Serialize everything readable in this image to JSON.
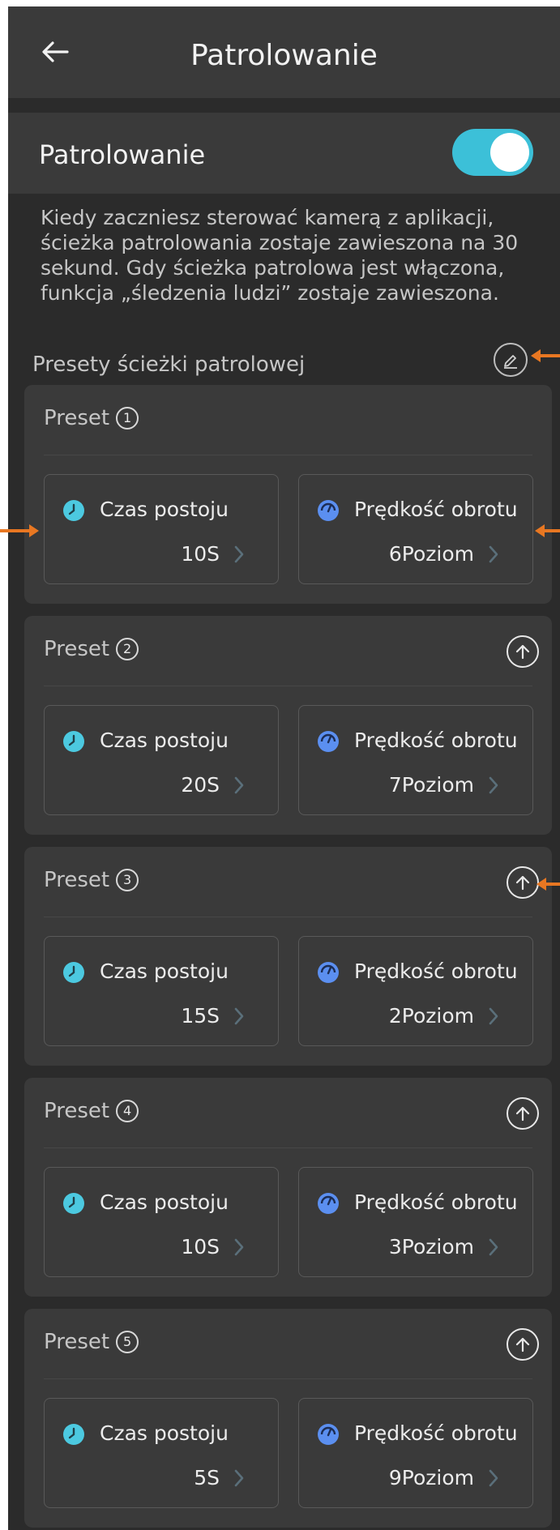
{
  "header": {
    "title": "Patrolowanie"
  },
  "toggle": {
    "label": "Patrolowanie",
    "state": "on"
  },
  "description": "Kiedy zaczniesz sterować kamerą z aplikacji, ścieżka patrolowania zostaje zawieszona na 30 sekund. Gdy ścieżka patrolowa jest włączona, funkcja „śledzenia ludzi” zostaje zawieszona.",
  "section": {
    "title": "Presety ścieżki patrolowej"
  },
  "colors": {
    "accent": "#3cc0d8",
    "annotation": "#e87722",
    "clock": "#4cc9e0",
    "gauge": "#5b8ff0"
  },
  "presets": [
    {
      "label": "Preset",
      "number": "1",
      "dwell_label": "Czas postoju",
      "dwell_value": "10S",
      "speed_label": "Prędkość obrotu",
      "speed_value": "6Poziom"
    },
    {
      "label": "Preset",
      "number": "2",
      "dwell_label": "Czas postoju",
      "dwell_value": "20S",
      "speed_label": "Prędkość obrotu",
      "speed_value": "7Poziom"
    },
    {
      "label": "Preset",
      "number": "3",
      "dwell_label": "Czas postoju",
      "dwell_value": "15S",
      "speed_label": "Prędkość obrotu",
      "speed_value": "2Poziom"
    },
    {
      "label": "Preset",
      "number": "4",
      "dwell_label": "Czas postoju",
      "dwell_value": "10S",
      "speed_label": "Prędkość obrotu",
      "speed_value": "3Poziom"
    },
    {
      "label": "Preset",
      "number": "5",
      "dwell_label": "Czas postoju",
      "dwell_value": "5S",
      "speed_label": "Prędkość obrotu",
      "speed_value": "9Poziom"
    }
  ]
}
